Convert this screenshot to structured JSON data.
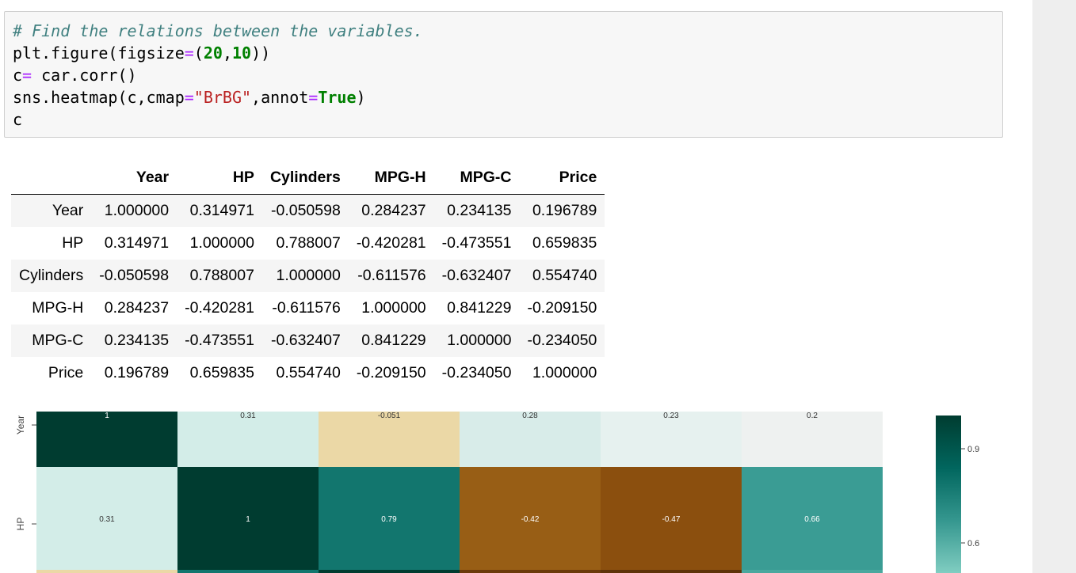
{
  "code_cell": {
    "lines": [
      [
        {
          "t": "cm",
          "v": "# Find the relations between the variables."
        }
      ],
      [
        {
          "t": "",
          "v": "plt.figure(figsize"
        },
        {
          "t": "op",
          "v": "="
        },
        {
          "t": "",
          "v": "("
        },
        {
          "t": "num",
          "v": "20"
        },
        {
          "t": "",
          "v": ","
        },
        {
          "t": "num",
          "v": "10"
        },
        {
          "t": "",
          "v": "))"
        }
      ],
      [
        {
          "t": "",
          "v": "c"
        },
        {
          "t": "op",
          "v": "="
        },
        {
          "t": "",
          "v": " car.corr()"
        }
      ],
      [
        {
          "t": "",
          "v": "sns.heatmap(c,cmap"
        },
        {
          "t": "op",
          "v": "="
        },
        {
          "t": "str",
          "v": "\"BrBG\""
        },
        {
          "t": "",
          "v": ",annot"
        },
        {
          "t": "op",
          "v": "="
        },
        {
          "t": "kw",
          "v": "True"
        },
        {
          "t": "",
          "v": ")"
        }
      ],
      [
        {
          "t": "",
          "v": "c"
        }
      ]
    ]
  },
  "corr_table": {
    "columns": [
      "Year",
      "HP",
      "Cylinders",
      "MPG-H",
      "MPG-C",
      "Price"
    ],
    "rows": [
      {
        "label": "Year",
        "values": [
          "1.000000",
          "0.314971",
          "-0.050598",
          "0.284237",
          "0.234135",
          "0.196789"
        ]
      },
      {
        "label": "HP",
        "values": [
          "0.314971",
          "1.000000",
          "0.788007",
          "-0.420281",
          "-0.473551",
          "0.659835"
        ]
      },
      {
        "label": "Cylinders",
        "values": [
          "-0.050598",
          "0.788007",
          "1.000000",
          "-0.611576",
          "-0.632407",
          "0.554740"
        ]
      },
      {
        "label": "MPG-H",
        "values": [
          "0.284237",
          "-0.420281",
          "-0.611576",
          "1.000000",
          "0.841229",
          "-0.209150"
        ]
      },
      {
        "label": "MPG-C",
        "values": [
          "0.234135",
          "-0.473551",
          "-0.632407",
          "0.841229",
          "1.000000",
          "-0.234050"
        ]
      },
      {
        "label": "Price",
        "values": [
          "0.196789",
          "0.659835",
          "0.554740",
          "-0.209150",
          "-0.234050",
          "1.000000"
        ]
      }
    ]
  },
  "chart_data": {
    "type": "heatmap",
    "cmap": "BrBG",
    "rows": [
      "Year",
      "HP"
    ],
    "columns_count": 6,
    "values": [
      [
        1.0,
        0.31,
        -0.051,
        0.28,
        0.23,
        0.2
      ],
      [
        0.31,
        1.0,
        0.79,
        -0.42,
        -0.47,
        0.66
      ]
    ],
    "annotations": [
      [
        "1",
        "0.31",
        "-0.051",
        "0.28",
        "0.23",
        "0.2"
      ],
      [
        "0.31",
        "1",
        "0.79",
        "-0.42",
        "-0.47",
        "0.66"
      ]
    ],
    "cell_colors": [
      [
        "#003c30",
        "#d3ede8",
        "#ebd8a6",
        "#d8ece9",
        "#e6f1ef",
        "#eef1f0"
      ],
      [
        "#d3ede8",
        "#003c30",
        "#12766e",
        "#985e15",
        "#8b4f0e",
        "#3a9c94"
      ]
    ],
    "next_row_colors": [
      "#ebd8a6",
      "#12766e",
      "#003c30",
      "#6b3a0a",
      "#5e3309",
      "#4aa89e"
    ],
    "colorbar": {
      "ticks": [
        "0.9",
        "0.6"
      ],
      "tick_values": [
        0.9,
        0.6
      ],
      "visible_range": [
        0.5,
        1.0
      ],
      "colors": [
        "#003c30",
        "#01665e",
        "#35978f",
        "#80cdc1"
      ]
    }
  }
}
